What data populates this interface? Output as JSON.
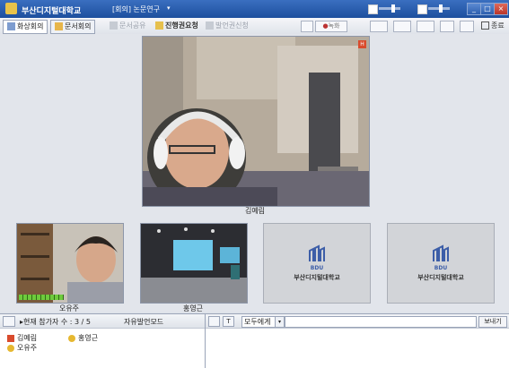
{
  "titlebar": {
    "app_title": "부산디지털대학교",
    "meeting": "[회의] 논문연구"
  },
  "toolbar": {
    "tab_video": "화상회의",
    "tab_doc": "문서회의",
    "share_doc": "문서공유",
    "request_progress": "진행권요청",
    "request_speak": "발언권신청",
    "record": "녹화"
  },
  "videos": {
    "main_name": "김예림",
    "p1_name": "오유주",
    "p2_name": "홍영근",
    "school_name_1": "부산디지털대학교",
    "school_name_2": "부산디지털대학교",
    "bdu": "BDU"
  },
  "participants": {
    "count_label": "▸현재 참가자 수 : 3 / 5",
    "mode_label": "자유발언모드",
    "list": [
      "김예림",
      "홍영근",
      "오유주"
    ]
  },
  "chat": {
    "target": "모두에게",
    "send": "보내기"
  },
  "colors": {
    "titlebar": "#1d4f9e",
    "stage": "#e2e5eb"
  }
}
